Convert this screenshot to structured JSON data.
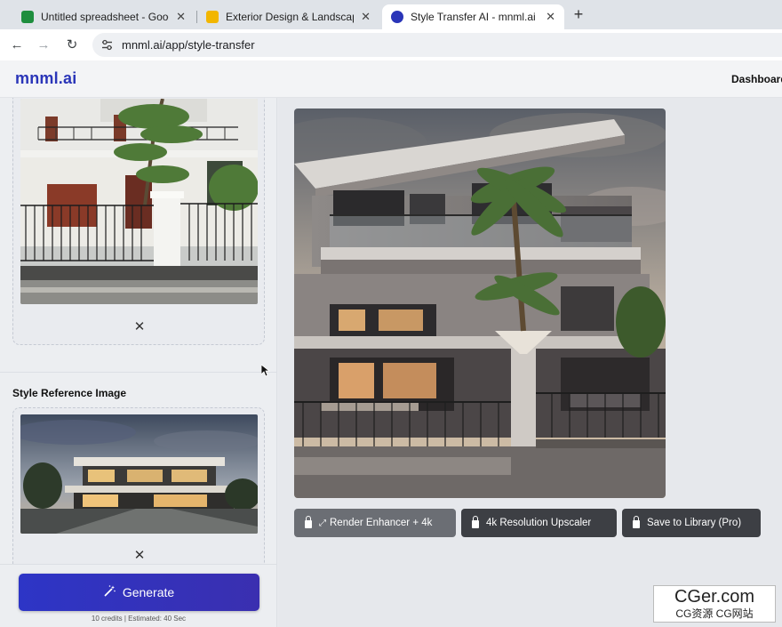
{
  "browser": {
    "tabs": [
      {
        "title": "Untitled spreadsheet - Google Sheets",
        "favicon_color": "#1e8e3e",
        "active": false
      },
      {
        "title": "Exterior Design & Landscape",
        "favicon_color": "#f2b600",
        "active": false
      },
      {
        "title": "Style Transfer AI - mnml.ai",
        "favicon_color": "#2a35b8",
        "active": true
      }
    ],
    "new_tab": "+",
    "close_glyph": "✕",
    "url": "mnml.ai/app/style-transfer"
  },
  "app": {
    "logo": "mnml.ai",
    "nav_link": "Dashboard",
    "sidebar": {
      "upload_remove": "✕",
      "style_section_title": "Style Reference Image",
      "style_remove": "✕",
      "generate_label": "Generate",
      "generate_icon": "magic-wand-icon",
      "credits_note": "10 credits | Estimated: 40 Sec"
    },
    "actions": [
      {
        "label": "Render Enhancer + 4k",
        "icon": "lock-icon",
        "extra_icon": "sparkle-icon"
      },
      {
        "label": "4k Resolution Upscaler",
        "icon": "lock-icon"
      },
      {
        "label": "Save to Library (Pro)",
        "icon": "lock-icon"
      }
    ],
    "accent_color": "#2d35c6"
  },
  "watermark": {
    "line1": "CGer.com",
    "line2": "CG资源 CG网站"
  }
}
